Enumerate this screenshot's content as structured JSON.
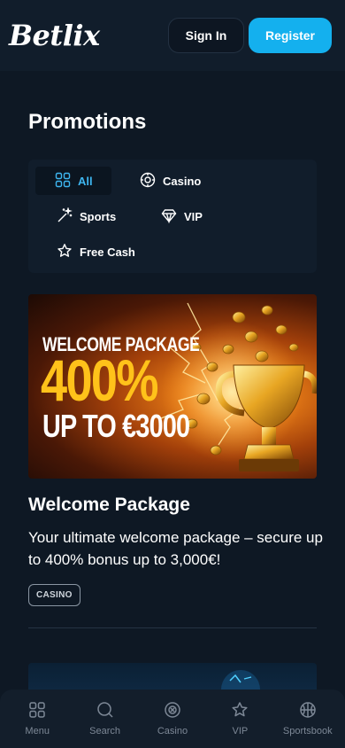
{
  "header": {
    "logo_text": "Betlix",
    "signin_label": "Sign In",
    "register_label": "Register"
  },
  "page": {
    "title": "Promotions"
  },
  "filters": [
    {
      "label": "All",
      "icon": "grid-icon",
      "active": true
    },
    {
      "label": "Casino",
      "icon": "roulette-icon",
      "active": false
    },
    {
      "label": "Sports",
      "icon": "wand-icon",
      "active": false
    },
    {
      "label": "VIP",
      "icon": "diamond-icon",
      "active": false
    },
    {
      "label": "Free Cash",
      "icon": "star-icon",
      "active": false
    }
  ],
  "promo": {
    "banner_line1": "WELCOME PACKAGE",
    "banner_line2": "400%",
    "banner_line3": "UP TO €3000",
    "title": "Welcome Package",
    "description": "Your ultimate welcome package – secure up to 400% bonus up to 3,000€!",
    "tag": "CASINO"
  },
  "bottom_nav": [
    {
      "label": "Menu",
      "icon": "grid-icon"
    },
    {
      "label": "Search",
      "icon": "search-icon"
    },
    {
      "label": "Casino",
      "icon": "roulette-icon"
    },
    {
      "label": "VIP",
      "icon": "star-icon"
    },
    {
      "label": "Sportsbook",
      "icon": "basketball-icon"
    }
  ],
  "colors": {
    "background": "#0e1824",
    "panel": "#111d2b",
    "accent": "#14b0ee",
    "banner_gold": "#ffc21a"
  }
}
